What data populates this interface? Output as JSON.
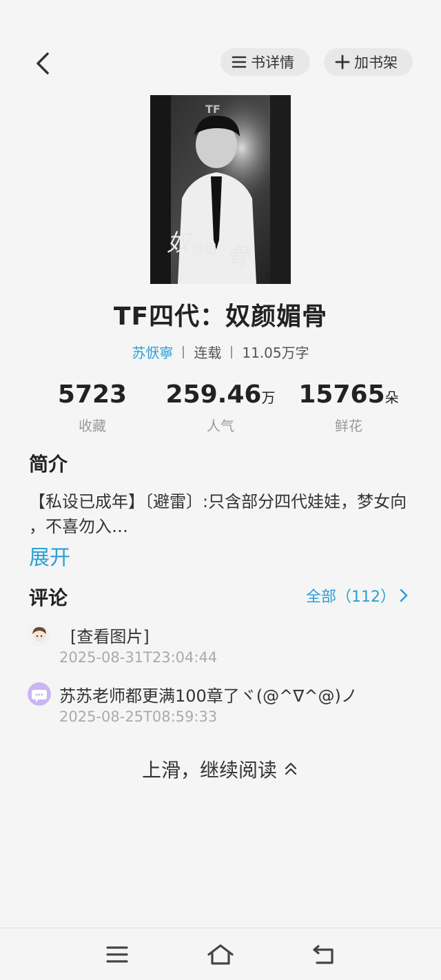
{
  "header": {
    "detail_label": "书详情",
    "shelf_label": "加书架"
  },
  "book": {
    "title": "TF四代：奴颜媚骨",
    "author": "苏恹寧",
    "status": "连载",
    "word_count": "11.05万字"
  },
  "stats": [
    {
      "value": "5723",
      "unit": "",
      "label": "收藏"
    },
    {
      "value": "259.46",
      "unit": "万",
      "label": "人气"
    },
    {
      "value": "15765",
      "unit": "朵",
      "label": "鲜花"
    }
  ],
  "intro": {
    "heading": "简介",
    "text": "【私设已成年】〔避雷〕:只含部分四代娃娃，梦女向 ，不喜勿入…",
    "expand_label": "展开"
  },
  "comments": {
    "heading": "评论",
    "all_label": "全部（112）",
    "items": [
      {
        "text": "[查看图片]",
        "time": "2025-08-31T23:04:44"
      },
      {
        "text": "苏苏老师都更满100章了ヾ(@^∇^@)ノ",
        "time": "2025-08-25T08:59:33"
      }
    ]
  },
  "continue_label": "上滑，继续阅读",
  "colors": {
    "accent": "#2a9fd6",
    "background": "#f5f5f5"
  },
  "icons": {
    "back": "chevron-left-icon",
    "detail": "list-icon",
    "shelf": "plus-icon",
    "more": "chevron-right-icon",
    "continue": "double-chevron-up-icon",
    "nav_menu": "menu-icon",
    "nav_home": "home-icon",
    "nav_back": "return-icon"
  }
}
